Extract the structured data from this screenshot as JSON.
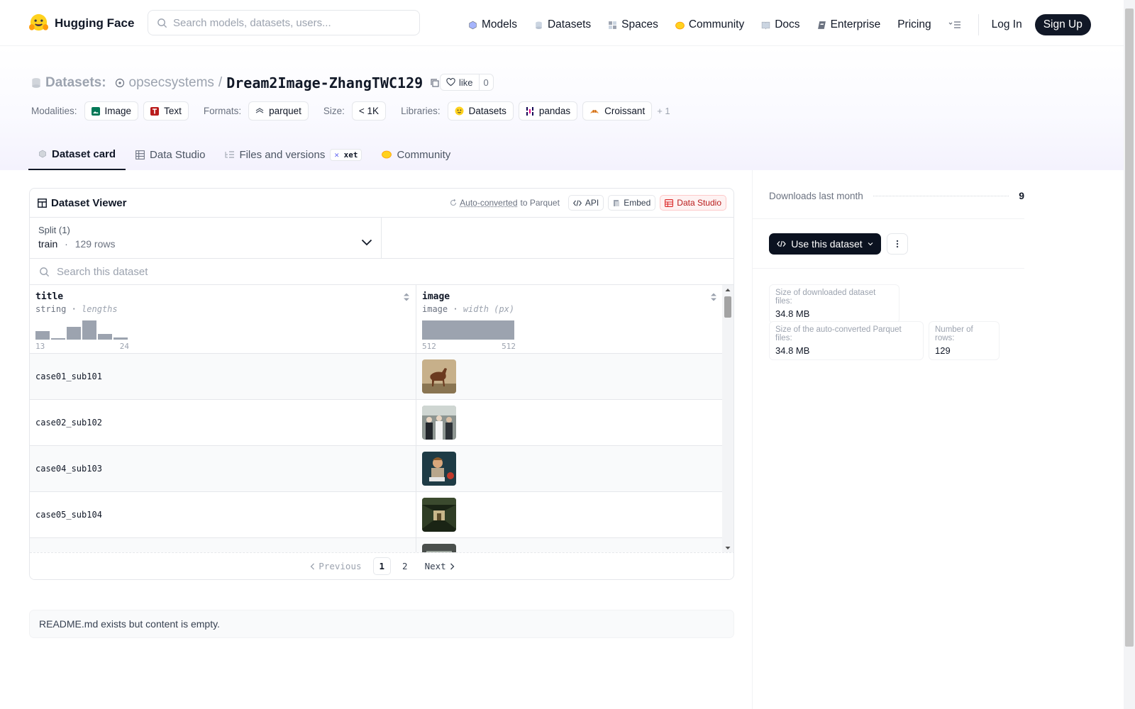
{
  "header": {
    "brand": "Hugging Face",
    "search_placeholder": "Search models, datasets, users...",
    "nav": [
      {
        "label": "Models",
        "icon": "models-icon"
      },
      {
        "label": "Datasets",
        "icon": "datasets-icon"
      },
      {
        "label": "Spaces",
        "icon": "spaces-icon"
      },
      {
        "label": "Community",
        "icon": "community-icon"
      },
      {
        "label": "Docs",
        "icon": "docs-icon"
      },
      {
        "label": "Enterprise",
        "icon": "enterprise-icon"
      },
      {
        "label": "Pricing"
      }
    ],
    "login": "Log In",
    "signup": "Sign Up"
  },
  "repo": {
    "type_label": "Datasets:",
    "owner": "opsecsystems",
    "separator": "/",
    "name": "Dream2Image-ZhangTWC129",
    "like_label": "like",
    "like_count": "0"
  },
  "tags": {
    "modalities_label": "Modalities:",
    "modalities": [
      "Image",
      "Text"
    ],
    "formats_label": "Formats:",
    "formats": [
      "parquet"
    ],
    "size_label": "Size:",
    "size": "< 1K",
    "libraries_label": "Libraries:",
    "libraries": [
      "Datasets",
      "pandas",
      "Croissant"
    ],
    "more": "+ 1"
  },
  "tabs": {
    "card": "Dataset card",
    "studio": "Data Studio",
    "files": "Files and versions",
    "xet": "xet",
    "community": "Community"
  },
  "viewer": {
    "title": "Dataset Viewer",
    "autoconv_link": "Auto-converted",
    "autoconv_rest": "to Parquet",
    "api": "API",
    "embed": "Embed",
    "studio": "Data Studio",
    "split_label": "Split (1)",
    "split_value": "train",
    "split_dot": "·",
    "split_rows": "129 rows",
    "search_placeholder": "Search this dataset",
    "columns": [
      {
        "name": "title",
        "type": "string",
        "stat": "lengths",
        "min": "13",
        "max": "24",
        "hist": [
          0.45,
          0.08,
          0.65,
          1.0,
          0.28,
          0.12
        ]
      },
      {
        "name": "image",
        "type": "image",
        "stat": "width (px)",
        "min": "512",
        "max": "512",
        "hist": [
          1.0
        ]
      }
    ],
    "rows": [
      {
        "title": "case01_sub101",
        "image": "horse-photo"
      },
      {
        "title": "case02_sub102",
        "image": "crowd-photo"
      },
      {
        "title": "case04_sub103",
        "image": "child-photo"
      },
      {
        "title": "case05_sub104",
        "image": "corridor-photo"
      },
      {
        "title": "",
        "image": "partial-photo"
      }
    ],
    "pager": {
      "prev": "Previous",
      "pages": [
        "1",
        "2"
      ],
      "next": "Next"
    }
  },
  "readme": "README.md exists but content is empty.",
  "sidebar": {
    "downloads_label": "Downloads last month",
    "downloads": "9",
    "use_button": "Use this dataset",
    "stats": {
      "dl_size_label": "Size of downloaded dataset files:",
      "dl_size": "34.8 MB",
      "parquet_label": "Size of the auto-converted Parquet files:",
      "parquet_size": "34.8 MB",
      "rows_label": "Number of rows:",
      "rows": "129"
    }
  },
  "colors": {
    "accent": "#111827",
    "muted": "#6b7280",
    "studio_red": "#b91c1c",
    "hf_yellow": "#FFD21E"
  }
}
